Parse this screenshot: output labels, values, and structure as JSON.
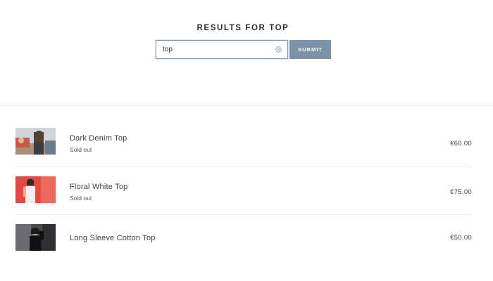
{
  "header": {
    "title": "RESULTS FOR TOP"
  },
  "search": {
    "value": "top",
    "submit_label": "SUBMIT"
  },
  "results": [
    {
      "title": "Dark Denim Top",
      "status": "Sold out",
      "price": "€60.00",
      "image": "woman-denim-top-photo"
    },
    {
      "title": "Floral White Top",
      "status": "Sold out",
      "price": "€75.00",
      "image": "woman-white-top-red-background-photo"
    },
    {
      "title": "Long Sleeve Cotton Top",
      "status": "",
      "price": "€50.00",
      "image": "woman-black-long-sleeve-photo"
    }
  ],
  "colors": {
    "accent": "#7b93a9",
    "input_border": "#7a96b0",
    "divider": "#ececec"
  }
}
